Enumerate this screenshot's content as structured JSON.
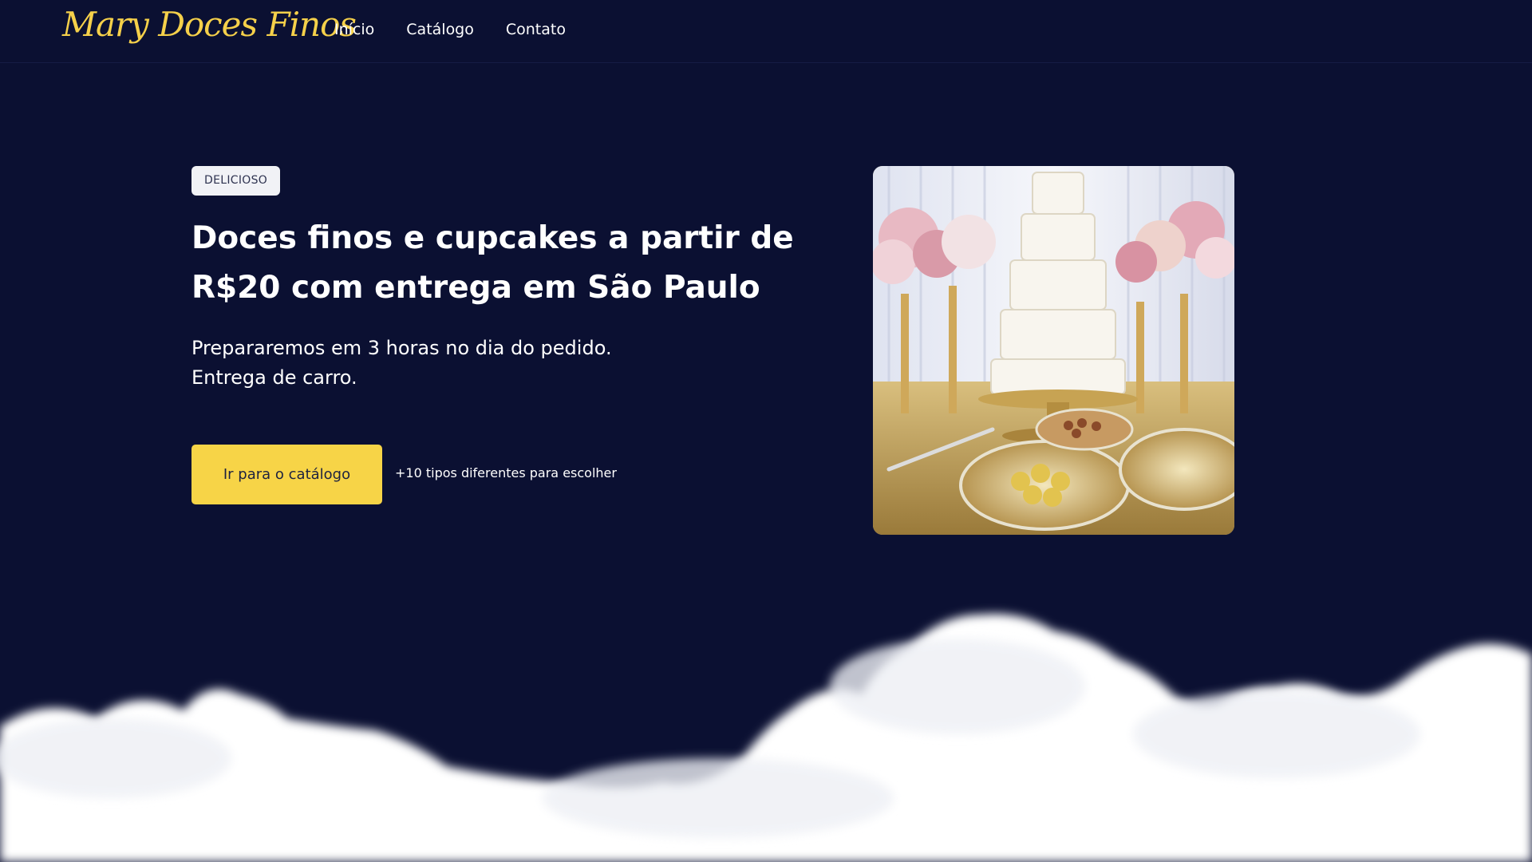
{
  "header": {
    "logo_text": "Mary Doces Finos",
    "nav": [
      {
        "label": "Início"
      },
      {
        "label": "Catálogo"
      },
      {
        "label": "Contato"
      }
    ]
  },
  "hero": {
    "badge": "DELICIOSO",
    "headline": "Doces finos e cupcakes a partir de R$20 com entrega em São Paulo",
    "subtext_lines": [
      "Prepararemos em 3 horas no dia do pedido.",
      "Entrega de carro."
    ],
    "cta_label": "Ir para o catálogo",
    "cta_note": "+10 tipos diferentes para escolher"
  },
  "colors": {
    "background": "#0b1032",
    "accent": "#f7d447",
    "logo": "#f5d04a"
  }
}
